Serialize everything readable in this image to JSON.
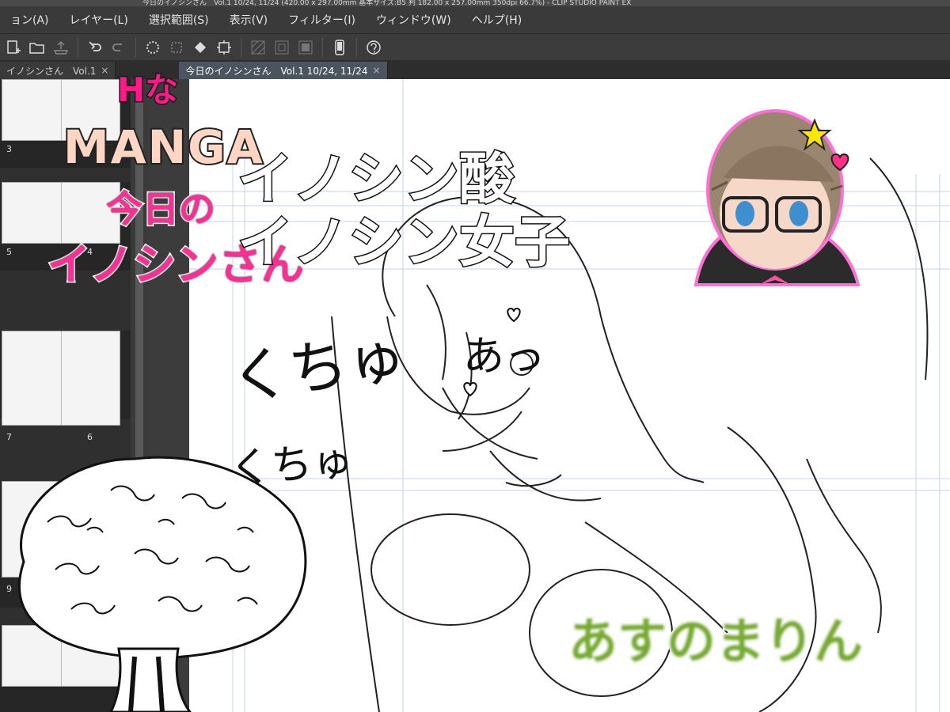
{
  "window": {
    "title_fragment": "今日のイノシンさん　Vol.1 10/24, 11/24 (420.00 x 297.00mm 基本サイズ:B5 判 182.00 x 257.00mm 350dpi 66.7%) - CLIP STUDIO PAINT EX"
  },
  "menu": {
    "items": [
      "ョン(A)",
      "レイヤー(L)",
      "選択範囲(S)",
      "表示(V)",
      "フィルター(I)",
      "ウィンドウ(W)",
      "ヘルプ(H)"
    ]
  },
  "tabs": [
    {
      "label": "イノシンさん　Vol.1",
      "active": false
    },
    {
      "label": "今日のイノシンさん　Vol.1 10/24, 11/24",
      "active": true
    }
  ],
  "tab_close_glyph": "×",
  "pages": {
    "labels": [
      "3",
      "5",
      "4",
      "7",
      "6",
      "9"
    ]
  },
  "overlay": {
    "h_na": "Hな",
    "manga": "MANGA",
    "kyou_no": "今日の",
    "inoshin_san": "イノシンさん",
    "acid": "イノシン酸",
    "girl": "イノシン女子",
    "sfx_kucha_1": "くちゅ",
    "sfx_kucha_2": "くちゅ",
    "sfx_ah": "あっ",
    "author": "あすのまりん"
  },
  "colors": {
    "menubar": "#3a3a3a",
    "canvas": "#ffffff",
    "pink": "#ff2d96",
    "guide": "#b7c7e6"
  },
  "icons": [
    "new-file-icon",
    "open-folder-icon",
    "upload-icon",
    "undo-icon",
    "redo-icon",
    "loading-icon",
    "transform-icon",
    "fill-icon",
    "crop-icon",
    "grid-icon",
    "smartphone-icon",
    "help-icon",
    "heart-icon",
    "star-icon"
  ]
}
